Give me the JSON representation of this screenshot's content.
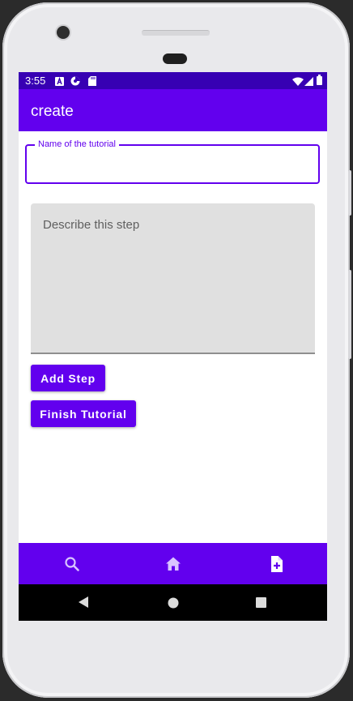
{
  "status_bar": {
    "time": "3:55",
    "left_icons": [
      "a-icon",
      "pie-icon",
      "sd-card-icon"
    ],
    "right_icons": [
      "wifi-icon",
      "signal-icon",
      "battery-icon"
    ]
  },
  "app_bar": {
    "title": "create"
  },
  "form": {
    "name_label": "Name of the tutorial",
    "name_value": "",
    "step_placeholder": "Describe this step",
    "add_step_label": "Add Step",
    "finish_label": "Finish Tutorial"
  },
  "bottom_nav": {
    "items": [
      "search-icon",
      "home-icon",
      "add-document-icon"
    ]
  },
  "system_nav": {
    "items": [
      "back-icon",
      "home-circle-icon",
      "recents-icon"
    ]
  },
  "colors": {
    "primary": "#6200ee",
    "primary_dark": "#3700b3",
    "field_fill": "#e0e0e0"
  }
}
